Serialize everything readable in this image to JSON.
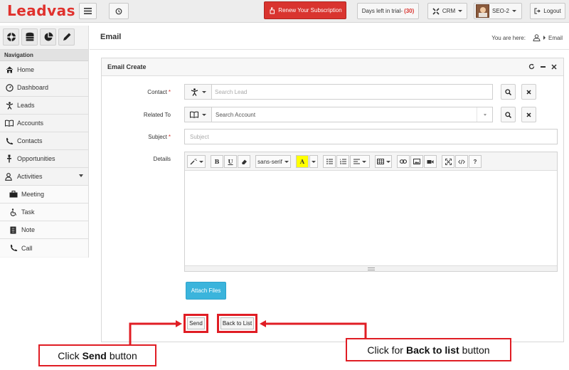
{
  "app": {
    "logo": "Leadvas"
  },
  "topbar": {
    "renew_label": "Renew Your Subscription",
    "trial_label": "Days left in trial-",
    "trial_count": "(30)",
    "crm_label": "CRM",
    "user_label": "SEO-2",
    "logout_label": "Logout"
  },
  "sidebar": {
    "nav_heading": "Navigation",
    "items": [
      {
        "label": "Home",
        "icon": "home-icon"
      },
      {
        "label": "Dashboard",
        "icon": "dashboard-icon"
      },
      {
        "label": "Leads",
        "icon": "leads-icon"
      },
      {
        "label": "Accounts",
        "icon": "accounts-icon"
      },
      {
        "label": "Contacts",
        "icon": "phone-icon"
      },
      {
        "label": "Opportunities",
        "icon": "opportunity-icon"
      },
      {
        "label": "Activities",
        "icon": "activities-icon"
      }
    ],
    "sub_items": [
      {
        "label": "Meeting",
        "icon": "briefcase-icon"
      },
      {
        "label": "Task",
        "icon": "task-icon"
      },
      {
        "label": "Note",
        "icon": "note-icon"
      },
      {
        "label": "Call",
        "icon": "call-icon"
      }
    ]
  },
  "header": {
    "page_title": "Email",
    "breadcrumb_prefix": "You are here:",
    "breadcrumb_current": "Email"
  },
  "panel": {
    "title": "Email Create",
    "contact_label": "Contact",
    "contact_placeholder": "Search Lead",
    "related_label": "Related To",
    "related_value": "Search Account",
    "subject_label": "Subject",
    "subject_placeholder": "Subject",
    "details_label": "Details",
    "required_mark": "*",
    "font_name": "sans-serif",
    "attach_label": "Attach Files",
    "send_label": "Send",
    "back_label": "Back to List"
  },
  "annotations": {
    "send_prefix": "Click",
    "send_bold": "Send",
    "send_suffix": "button",
    "back_prefix": "Click for",
    "back_bold": "Back to list",
    "back_suffix": "button"
  },
  "colors": {
    "brand_red": "#e0312d",
    "callout_red": "#e01d24",
    "attach_blue": "#3bb4dc"
  }
}
